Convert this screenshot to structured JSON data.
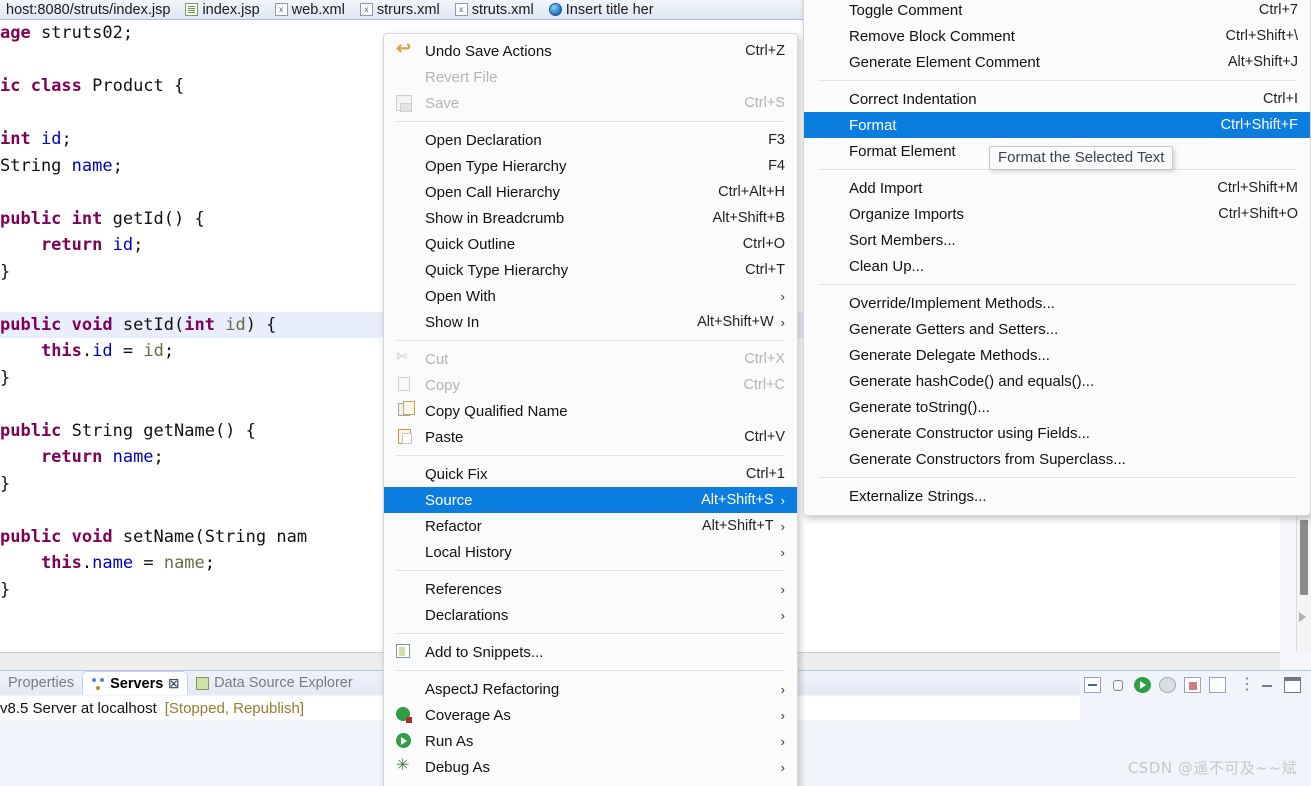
{
  "tabs": [
    {
      "label": "host:8080/struts/index.jsp",
      "icon": "",
      "active": false
    },
    {
      "label": "index.jsp",
      "icon": "doc-icon",
      "active": false
    },
    {
      "label": "web.xml",
      "icon": "xml-icon",
      "active": false
    },
    {
      "label": "strurs.xml",
      "icon": "xml-icon",
      "active": false
    },
    {
      "label": "struts.xml",
      "icon": "xml-icon",
      "active": false
    },
    {
      "label": "Insert title her",
      "icon": "globe-icon",
      "active": false
    }
  ],
  "editor": {
    "lines": [
      {
        "segments": [
          {
            "t": "age ",
            "c": "kw"
          },
          {
            "t": "struts02;",
            "c": "pl"
          }
        ],
        "highlight": false
      },
      {
        "segments": [],
        "highlight": false
      },
      {
        "segments": [
          {
            "t": "ic class ",
            "c": "kw"
          },
          {
            "t": "Product {",
            "c": "pl"
          }
        ],
        "highlight": false
      },
      {
        "segments": [],
        "highlight": false
      },
      {
        "segments": [
          {
            "t": "int ",
            "c": "kw"
          },
          {
            "t": "id",
            "c": "fld"
          },
          {
            "t": ";",
            "c": "pl"
          }
        ],
        "highlight": false
      },
      {
        "segments": [
          {
            "t": "String ",
            "c": "pl"
          },
          {
            "t": "name",
            "c": "fld"
          },
          {
            "t": ";",
            "c": "pl"
          }
        ],
        "highlight": false
      },
      {
        "segments": [],
        "highlight": false
      },
      {
        "segments": [
          {
            "t": "public int ",
            "c": "kw"
          },
          {
            "t": "getId() {",
            "c": "pl"
          }
        ],
        "highlight": false
      },
      {
        "segments": [
          {
            "t": "    return ",
            "c": "kw"
          },
          {
            "t": "id",
            "c": "fld"
          },
          {
            "t": ";",
            "c": "pl"
          }
        ],
        "highlight": false
      },
      {
        "segments": [
          {
            "t": "}",
            "c": "pl"
          }
        ],
        "highlight": false
      },
      {
        "segments": [],
        "highlight": false
      },
      {
        "segments": [
          {
            "t": "public void ",
            "c": "kw"
          },
          {
            "t": "setId(",
            "c": "pl"
          },
          {
            "t": "int ",
            "c": "kw"
          },
          {
            "t": "id",
            "c": "prm"
          },
          {
            "t": ") {",
            "c": "pl"
          }
        ],
        "highlight": true
      },
      {
        "segments": [
          {
            "t": "    ",
            "c": "pl"
          },
          {
            "t": "this",
            "c": "kw"
          },
          {
            "t": ".",
            "c": "pl"
          },
          {
            "t": "id",
            "c": "fld"
          },
          {
            "t": " = ",
            "c": "pl"
          },
          {
            "t": "id",
            "c": "prm"
          },
          {
            "t": ";",
            "c": "pl"
          }
        ],
        "highlight": false
      },
      {
        "segments": [
          {
            "t": "}",
            "c": "pl"
          }
        ],
        "highlight": false
      },
      {
        "segments": [],
        "highlight": false
      },
      {
        "segments": [
          {
            "t": "public ",
            "c": "kw"
          },
          {
            "t": "String getName() {",
            "c": "pl"
          }
        ],
        "highlight": false
      },
      {
        "segments": [
          {
            "t": "    return ",
            "c": "kw"
          },
          {
            "t": "name",
            "c": "fld"
          },
          {
            "t": ";",
            "c": "pl"
          }
        ],
        "highlight": false
      },
      {
        "segments": [
          {
            "t": "}",
            "c": "pl"
          }
        ],
        "highlight": false
      },
      {
        "segments": [],
        "highlight": false
      },
      {
        "segments": [
          {
            "t": "public void ",
            "c": "kw"
          },
          {
            "t": "setName(String nam",
            "c": "pl"
          }
        ],
        "highlight": false
      },
      {
        "segments": [
          {
            "t": "    ",
            "c": "pl"
          },
          {
            "t": "this",
            "c": "kw"
          },
          {
            "t": ".",
            "c": "pl"
          },
          {
            "t": "name",
            "c": "fld"
          },
          {
            "t": " = ",
            "c": "pl"
          },
          {
            "t": "name",
            "c": "prm"
          },
          {
            "t": ";",
            "c": "pl"
          }
        ],
        "highlight": false
      },
      {
        "segments": [
          {
            "t": "}",
            "c": "pl"
          }
        ],
        "highlight": false
      }
    ]
  },
  "context_menu": {
    "items": [
      {
        "type": "item",
        "label": "Undo Save Actions",
        "accel": "Ctrl+Z",
        "icon": "undo-icon",
        "disabled": false,
        "submenu": false
      },
      {
        "type": "item",
        "label": "Revert File",
        "accel": "",
        "icon": "",
        "disabled": true,
        "submenu": false
      },
      {
        "type": "item",
        "label": "Save",
        "accel": "Ctrl+S",
        "icon": "save-icon",
        "disabled": true,
        "submenu": false
      },
      {
        "type": "separator"
      },
      {
        "type": "item",
        "label": "Open Declaration",
        "accel": "F3",
        "icon": "",
        "disabled": false,
        "submenu": false
      },
      {
        "type": "item",
        "label": "Open Type Hierarchy",
        "accel": "F4",
        "icon": "",
        "disabled": false,
        "submenu": false
      },
      {
        "type": "item",
        "label": "Open Call Hierarchy",
        "accel": "Ctrl+Alt+H",
        "icon": "",
        "disabled": false,
        "submenu": false
      },
      {
        "type": "item",
        "label": "Show in Breadcrumb",
        "accel": "Alt+Shift+B",
        "icon": "",
        "disabled": false,
        "submenu": false
      },
      {
        "type": "item",
        "label": "Quick Outline",
        "accel": "Ctrl+O",
        "icon": "",
        "disabled": false,
        "submenu": false
      },
      {
        "type": "item",
        "label": "Quick Type Hierarchy",
        "accel": "Ctrl+T",
        "icon": "",
        "disabled": false,
        "submenu": false
      },
      {
        "type": "item",
        "label": "Open With",
        "accel": "",
        "icon": "",
        "disabled": false,
        "submenu": true
      },
      {
        "type": "item",
        "label": "Show In",
        "accel": "Alt+Shift+W",
        "icon": "",
        "disabled": false,
        "submenu": true
      },
      {
        "type": "separator"
      },
      {
        "type": "item",
        "label": "Cut",
        "accel": "Ctrl+X",
        "icon": "cut-icon",
        "disabled": true,
        "submenu": false
      },
      {
        "type": "item",
        "label": "Copy",
        "accel": "Ctrl+C",
        "icon": "copy-icon",
        "disabled": true,
        "submenu": false
      },
      {
        "type": "item",
        "label": "Copy Qualified Name",
        "accel": "",
        "icon": "copy-qualified-icon",
        "disabled": false,
        "submenu": false
      },
      {
        "type": "item",
        "label": "Paste",
        "accel": "Ctrl+V",
        "icon": "paste-icon",
        "disabled": false,
        "submenu": false
      },
      {
        "type": "separator"
      },
      {
        "type": "item",
        "label": "Quick Fix",
        "accel": "Ctrl+1",
        "icon": "",
        "disabled": false,
        "submenu": false
      },
      {
        "type": "item",
        "label": "Source",
        "accel": "Alt+Shift+S",
        "icon": "",
        "disabled": false,
        "submenu": true,
        "selected": true
      },
      {
        "type": "item",
        "label": "Refactor",
        "accel": "Alt+Shift+T",
        "icon": "",
        "disabled": false,
        "submenu": true
      },
      {
        "type": "item",
        "label": "Local History",
        "accel": "",
        "icon": "",
        "disabled": false,
        "submenu": true
      },
      {
        "type": "separator"
      },
      {
        "type": "item",
        "label": "References",
        "accel": "",
        "icon": "",
        "disabled": false,
        "submenu": true
      },
      {
        "type": "item",
        "label": "Declarations",
        "accel": "",
        "icon": "",
        "disabled": false,
        "submenu": true
      },
      {
        "type": "separator"
      },
      {
        "type": "item",
        "label": "Add to Snippets...",
        "accel": "",
        "icon": "snippets-icon",
        "disabled": false,
        "submenu": false
      },
      {
        "type": "separator"
      },
      {
        "type": "item",
        "label": "AspectJ Refactoring",
        "accel": "",
        "icon": "",
        "disabled": false,
        "submenu": true
      },
      {
        "type": "item",
        "label": "Coverage As",
        "accel": "",
        "icon": "coverage-icon",
        "disabled": false,
        "submenu": true
      },
      {
        "type": "item",
        "label": "Run As",
        "accel": "",
        "icon": "runas-icon",
        "disabled": false,
        "submenu": true
      },
      {
        "type": "item",
        "label": "Debug As",
        "accel": "",
        "icon": "debugas-icon",
        "disabled": false,
        "submenu": true
      }
    ]
  },
  "submenu": {
    "items": [
      {
        "type": "item",
        "label": "Toggle Comment",
        "accel": "Ctrl+7",
        "disabled": false,
        "submenu": false
      },
      {
        "type": "item",
        "label": "Remove Block Comment",
        "accel": "Ctrl+Shift+\\",
        "disabled": false,
        "submenu": false
      },
      {
        "type": "item",
        "label": "Generate Element Comment",
        "accel": "Alt+Shift+J",
        "disabled": false,
        "submenu": false
      },
      {
        "type": "separator"
      },
      {
        "type": "item",
        "label": "Correct Indentation",
        "accel": "Ctrl+I",
        "disabled": false,
        "submenu": false
      },
      {
        "type": "item",
        "label": "Format",
        "accel": "Ctrl+Shift+F",
        "disabled": false,
        "submenu": false,
        "selected": true
      },
      {
        "type": "item",
        "label": "Format Element",
        "accel": "",
        "disabled": false,
        "submenu": false
      },
      {
        "type": "separator"
      },
      {
        "type": "item",
        "label": "Add Import",
        "accel": "Ctrl+Shift+M",
        "disabled": false,
        "submenu": false
      },
      {
        "type": "item",
        "label": "Organize Imports",
        "accel": "Ctrl+Shift+O",
        "disabled": false,
        "submenu": false
      },
      {
        "type": "item",
        "label": "Sort Members...",
        "accel": "",
        "disabled": false,
        "submenu": false
      },
      {
        "type": "item",
        "label": "Clean Up...",
        "accel": "",
        "disabled": false,
        "submenu": false
      },
      {
        "type": "separator"
      },
      {
        "type": "item",
        "label": "Override/Implement Methods...",
        "accel": "",
        "disabled": false,
        "submenu": false
      },
      {
        "type": "item",
        "label": "Generate Getters and Setters...",
        "accel": "",
        "disabled": false,
        "submenu": false
      },
      {
        "type": "item",
        "label": "Generate Delegate Methods...",
        "accel": "",
        "disabled": false,
        "submenu": false
      },
      {
        "type": "item",
        "label": "Generate hashCode() and equals()...",
        "accel": "",
        "disabled": false,
        "submenu": false
      },
      {
        "type": "item",
        "label": "Generate toString()...",
        "accel": "",
        "disabled": false,
        "submenu": false
      },
      {
        "type": "item",
        "label": "Generate Constructor using Fields...",
        "accel": "",
        "disabled": false,
        "submenu": false
      },
      {
        "type": "item",
        "label": "Generate Constructors from Superclass...",
        "accel": "",
        "disabled": false,
        "submenu": false
      },
      {
        "type": "separator"
      },
      {
        "type": "item",
        "label": "Externalize Strings...",
        "accel": "",
        "disabled": false,
        "submenu": false
      }
    ]
  },
  "tooltip": {
    "text": "Format the Selected Text"
  },
  "bottom_panel": {
    "tabs": [
      {
        "label": "Properties",
        "icon": "",
        "active": false,
        "closable": false
      },
      {
        "label": "Servers",
        "icon": "srv-icon",
        "active": true,
        "closable": true
      },
      {
        "label": "Data Source Explorer",
        "icon": "dse-icon",
        "active": false,
        "closable": false
      }
    ],
    "server_name": "v8.5 Server at localhost",
    "server_status": "[Stopped, Republish]",
    "toolbar_icons": [
      "restore-icon",
      "debug-icon",
      "run-icon",
      "profile-icon",
      "stop-icon",
      "publish-icon",
      "menu-icon",
      "minimize-icon",
      "maximize-icon"
    ]
  },
  "watermark": {
    "text": "CSDN @遥不可及~~斌"
  },
  "colors": {
    "selection_blue": "#0a7ddf",
    "code_keyword": "#7f0055",
    "code_field": "#0000c0",
    "status_amber": "#9a7b2e"
  }
}
